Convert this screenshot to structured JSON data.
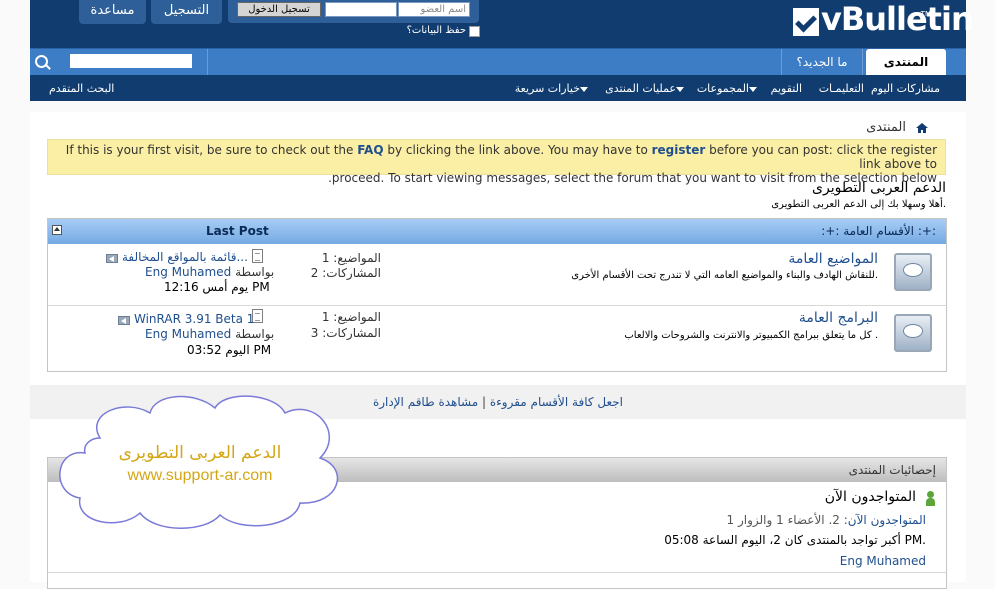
{
  "header": {
    "logo": "vBulletin",
    "logo_tm": "TM",
    "help_label": "مساعدة",
    "register_label": "التسجيل",
    "login_button_label": "تسجيل الدخول",
    "username_placeholder": "اسم العضو",
    "password_value": "",
    "remember_label": "حفظ البيانات؟"
  },
  "navbar": {
    "tab_forum": "المنتدى",
    "tab_whatsnew": "ما الجديد؟",
    "search_value": ""
  },
  "subnav": {
    "items": [
      {
        "label": "مشاركات اليوم",
        "dropdown": false
      },
      {
        "label": "التعليمـات",
        "dropdown": false
      },
      {
        "label": "التقويم",
        "dropdown": false
      },
      {
        "label": "المجموعات",
        "dropdown": true
      },
      {
        "label": "عمليات المنتدى",
        "dropdown": true
      },
      {
        "label": "خيارات سريعة",
        "dropdown": true
      }
    ],
    "advanced_search": "البحث المتقدم"
  },
  "breadcrumb": "المنتدى",
  "notice": {
    "part1": "If this is your first visit, be sure to check out the ",
    "faq": "FAQ",
    "part2": " by clicking the link above. You may have to ",
    "register": "register",
    "part3": " before you can post: click the register link above to",
    "line2": ".proceed. To start viewing messages, select the forum that you want to visit from the selection below"
  },
  "forum_header": {
    "title": "الدعم العربى التطويرى",
    "description": "أهلا وسهلا بك إلى الدعم العربى التطويرى."
  },
  "category": {
    "title": ":+: الأقسام العامة :+:",
    "last_post_header": "Last Post",
    "forums": [
      {
        "name": "المواضيع العامة",
        "description": "للنقاش الهادف والبناء والمواضيع العامه التي لا تندرج تحت الأقسام الأخرى.",
        "topics": "المواضيع: 1",
        "posts": "المشاركات: 2",
        "last_post_title": "قائمة بالمواقع المخالفة...",
        "by_label": "بواسطة",
        "last_post_user": "Eng Muhamed",
        "last_post_date": "يوم أمس 12:16 PM"
      },
      {
        "name": "البرامج العامة",
        "description": "كل ما يتعلق ببرامج الكمبيوتر والانترنت والشروحات والالعاب .",
        "topics": "المواضيع: 1",
        "posts": "المشاركات: 3",
        "last_post_title": "WinRAR 3.91 Beta 1",
        "by_label": "بواسطة",
        "last_post_user": "Eng Muhamed",
        "last_post_date": "اليوم 03:52 PM"
      }
    ]
  },
  "links": {
    "mark_read": "اجعل كافة الأقسام مقروءة",
    "separator": "|",
    "view_staff": "مشاهدة طاقم الإدارة"
  },
  "stats": {
    "title": "إحصائيات المنتدى",
    "online_title": "المتواجدون الآن",
    "online_prefix": "المتواجدون الآن:",
    "online_count": "2",
    "online_detail": ". الأعضاء 1 والزوار 1",
    "record": "أكبر تواجد بالمنتدى كان 2، اليوم الساعة 05:08 PM.",
    "member": "Eng Muhamed"
  },
  "watermark": {
    "line1": "الدعم العربى التطويرى",
    "line2": "www.support-ar.com"
  },
  "colors": {
    "header_bg": "#103c70",
    "navbar_bg": "#3d7dc5",
    "notice_bg": "#fbefa6",
    "link": "#1f4f8e",
    "watermark_text": "#d4a615"
  }
}
